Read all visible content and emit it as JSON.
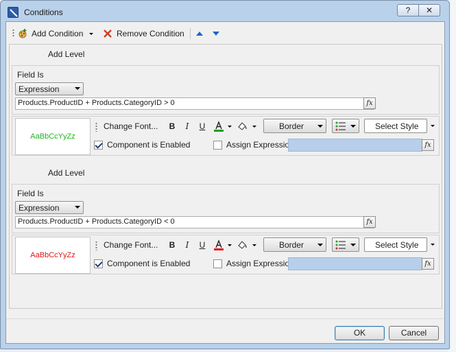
{
  "window": {
    "title": "Conditions",
    "help_label": "?",
    "close_label": "✕"
  },
  "toolbar": {
    "add_condition": "Add Condition",
    "remove_condition": "Remove Condition"
  },
  "levels": [
    {
      "add_level": "Add Level",
      "field_is_label": "Field Is",
      "field_is_value": "Expression",
      "expression": "Products.ProductID + Products.CategoryID > 0",
      "preview_text": "AaBbCcYyZz",
      "preview_color": "#1eb41e",
      "change_font": "Change Font...",
      "bold": "B",
      "italic": "I",
      "underline": "U",
      "font_color_bar": "#12a012",
      "border": "Border",
      "select_style": "Select Style",
      "component_enabled": "Component is Enabled",
      "assign_expression": "Assign Expression"
    },
    {
      "add_level": "Add Level",
      "field_is_label": "Field Is",
      "field_is_value": "Expression",
      "expression": "Products.ProductID + Products.CategoryID < 0",
      "preview_text": "AaBbCcYyZz",
      "preview_color": "#e01414",
      "change_font": "Change Font...",
      "bold": "B",
      "italic": "I",
      "underline": "U",
      "font_color_bar": "#e01414",
      "border": "Border",
      "select_style": "Select Style",
      "component_enabled": "Component is Enabled",
      "assign_expression": "Assign Expression"
    }
  ],
  "footer": {
    "ok": "OK",
    "cancel": "Cancel"
  },
  "fx_label": "fx"
}
